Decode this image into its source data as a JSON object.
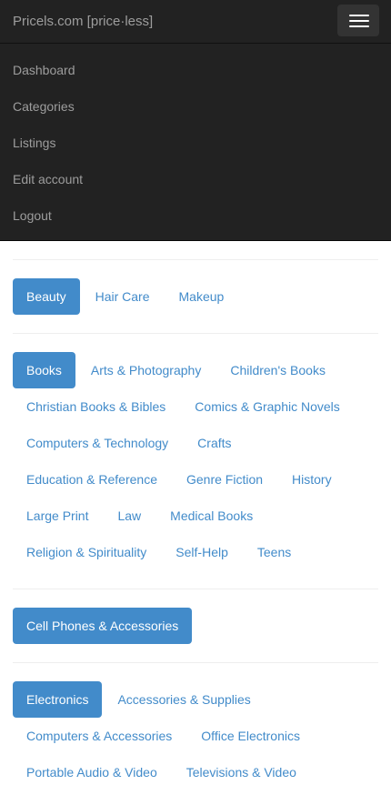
{
  "navbar": {
    "brand": "Pricels.com [price·less]",
    "menu": [
      {
        "label": "Dashboard"
      },
      {
        "label": "Categories"
      },
      {
        "label": "Listings"
      },
      {
        "label": "Edit account"
      },
      {
        "label": "Logout"
      }
    ]
  },
  "colors": {
    "navbar_bg": "#222222",
    "accent": "#428bca",
    "link": "#428bca"
  },
  "groups": [
    {
      "title": "Beauty",
      "items": [
        "Hair Care",
        "Makeup"
      ]
    },
    {
      "title": "Books",
      "items": [
        "Arts & Photography",
        "Children's Books",
        "Christian Books & Bibles",
        "Comics & Graphic Novels",
        "Computers & Technology",
        "Crafts",
        "Education & Reference",
        "Genre Fiction",
        "History",
        "Large Print",
        "Law",
        "Medical Books",
        "Religion & Spirituality",
        "Self-Help",
        "Teens"
      ]
    },
    {
      "title": "Cell Phones & Accessories",
      "items": []
    },
    {
      "title": "Electronics",
      "items": [
        "Accessories & Supplies",
        "Computers & Accessories",
        "Office Electronics",
        "Portable Audio & Video",
        "Televisions & Video"
      ]
    }
  ]
}
